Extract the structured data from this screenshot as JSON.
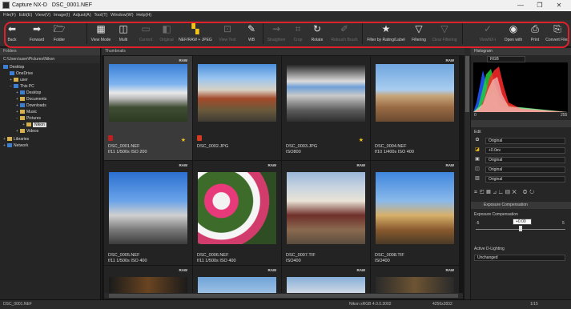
{
  "window": {
    "app_title": "Capture NX-D",
    "file_title": "DSC_0001.NEF",
    "minimize": "—",
    "maximize": "❐",
    "close": "✕"
  },
  "menu": [
    "File(F)",
    "Edit(E)",
    "View(V)",
    "Image(I)",
    "Adjust(A)",
    "Tool(T)",
    "Window(W)",
    "Help(H)"
  ],
  "toolbar": {
    "back": "Back",
    "forward": "Forward",
    "folder": "Folder",
    "view_mode": "View Mode",
    "multi": "Multi",
    "current": "Current",
    "original": "Original",
    "nef_jpeg": "NEF/RAW + JPEG",
    "view_text": "View Text",
    "wb": "WB",
    "straighten": "Straighten",
    "crop": "Crop",
    "rotate": "Rotate",
    "retouch": "Retouch Brush",
    "filter_rating": "Filter by Rating/Label",
    "filtering": "Filtering",
    "clear_filtering": "Clear Filtering",
    "view_nx": "ViewNX-i",
    "open_with": "Open with",
    "print": "Print",
    "convert": "Convert Files"
  },
  "left_panel": {
    "header": "Folders",
    "path": "C:\\Users\\user\\Pictures\\Nikon",
    "tree": {
      "desktop": "Desktop",
      "onedrive": "OneDrive",
      "user": "user",
      "this_pc": "This PC",
      "desktop2": "Desktop",
      "documents": "Documents",
      "downloads": "Downloads",
      "music": "Music",
      "pictures": "Pictures",
      "nikon": "Nikon",
      "videos": "Videos",
      "libraries": "Libraries",
      "network": "Network"
    }
  },
  "center": {
    "header": "Thumbnails",
    "files": [
      {
        "name": "DSC_0001.NEF",
        "meta": "f/11 1/500s ISO 200"
      },
      {
        "name": "DSC_0002.JPG",
        "meta": ""
      },
      {
        "name": "DSC_0003.JPG",
        "meta": "ISO800"
      },
      {
        "name": "DSC_0004.NEF",
        "meta": "f/10 1/400s ISO 400"
      },
      {
        "name": "DSC_0005.NEF",
        "meta": "f/11 1/500s ISO 400"
      },
      {
        "name": "DSC_0006.NEF",
        "meta": "f/11 1/500s ISO 400"
      },
      {
        "name": "DSC_0007.TIF",
        "meta": "ISO400"
      },
      {
        "name": "DSC_0008.TIF",
        "meta": "ISO400"
      }
    ],
    "raw_badge": "RAW"
  },
  "right_panel": {
    "histogram_header": "Histogram",
    "histogram_channel": "RGB",
    "histo_min": "0",
    "histo_max": "255",
    "edit_label": "Edit",
    "picture_control": "Original",
    "exposure": "+0.0ev",
    "wb": "Original",
    "tone": "Original",
    "lens": "Original",
    "exposure_comp_header": "Exposure Compensation",
    "exposure_comp_label": "Exposure Compensation",
    "slider_min": "-5",
    "slider_value": "+0.00",
    "slider_max": "5",
    "d_lighting_label": "Active D-Lighting",
    "d_lighting_value": "Unchanged"
  },
  "status": {
    "file": "DSC_0001.NEF",
    "profile": "Nikon sRGB 4.0.0.3002",
    "size": "4256x2832",
    "page": "1/15"
  }
}
